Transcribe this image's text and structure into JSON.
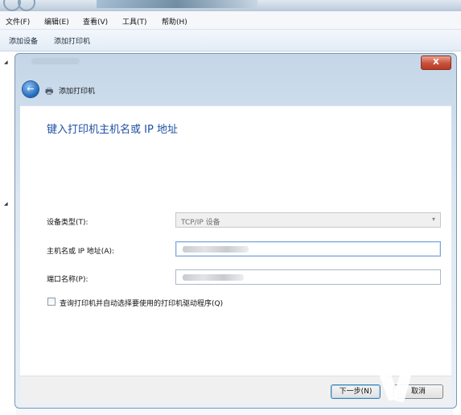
{
  "menubar": {
    "items": [
      "文件(F)",
      "编辑(E)",
      "查看(V)",
      "工具(T)",
      "帮助(H)"
    ]
  },
  "toolbar": {
    "add_device": "添加设备",
    "add_printer": "添加打印机"
  },
  "dialog": {
    "title": "添加打印机",
    "close_label": "X",
    "heading": "键入打印机主机名或 IP 地址",
    "device_type_label": "设备类型(T):",
    "device_type_value": "TCP/IP 设备",
    "hostname_label": "主机名或 IP 地址(A):",
    "port_label": "端口名称(P):",
    "query_checkbox_label": "查询打印机并自动选择要使用的打印机驱动程序(Q)",
    "next_button": "下一步(N)",
    "cancel_button": "取消"
  },
  "icons": {
    "back": "back-arrow-icon",
    "printer": "printer-icon",
    "close": "close-icon",
    "dropdown": "chevron-down-icon"
  },
  "colors": {
    "heading": "#1f4fa3",
    "close_button": "#c9503a"
  }
}
